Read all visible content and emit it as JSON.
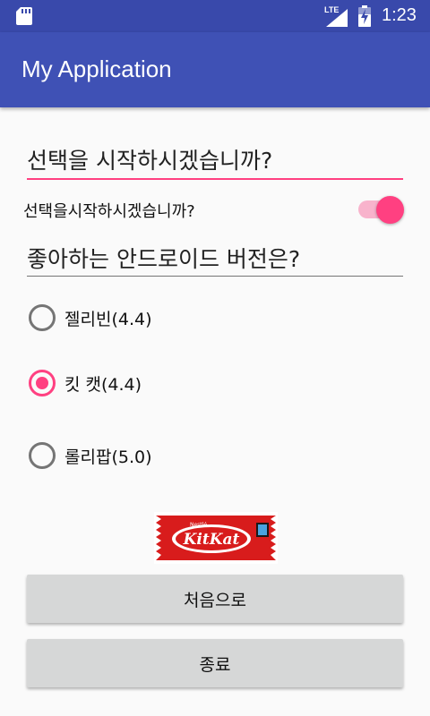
{
  "status_bar": {
    "network": "LTE",
    "time": "1:23",
    "icons": [
      "sd-card-icon",
      "signal-icon",
      "battery-icon"
    ]
  },
  "app_bar": {
    "title": "My Application",
    "color": "#3f51b5"
  },
  "form": {
    "question_1": "선택을 시작하시겠습니까?",
    "switch_label": "선택을시작하시겠습니까?",
    "switch_on": true,
    "question_2": "좋아하는 안드로이드 버전은?",
    "options": [
      {
        "label": "젤리빈(4.4)",
        "checked": false
      },
      {
        "label": "킷 캣(4.4)",
        "checked": true
      },
      {
        "label": "롤리팝(5.0)",
        "checked": false
      }
    ],
    "image": {
      "brand": "KitKat",
      "maker": "Nestlé"
    }
  },
  "buttons": {
    "restart": "처음으로",
    "exit": "종료"
  },
  "colors": {
    "accent": "#ff4081",
    "primary": "#3f51b5",
    "primary_dark": "#3949ab"
  }
}
